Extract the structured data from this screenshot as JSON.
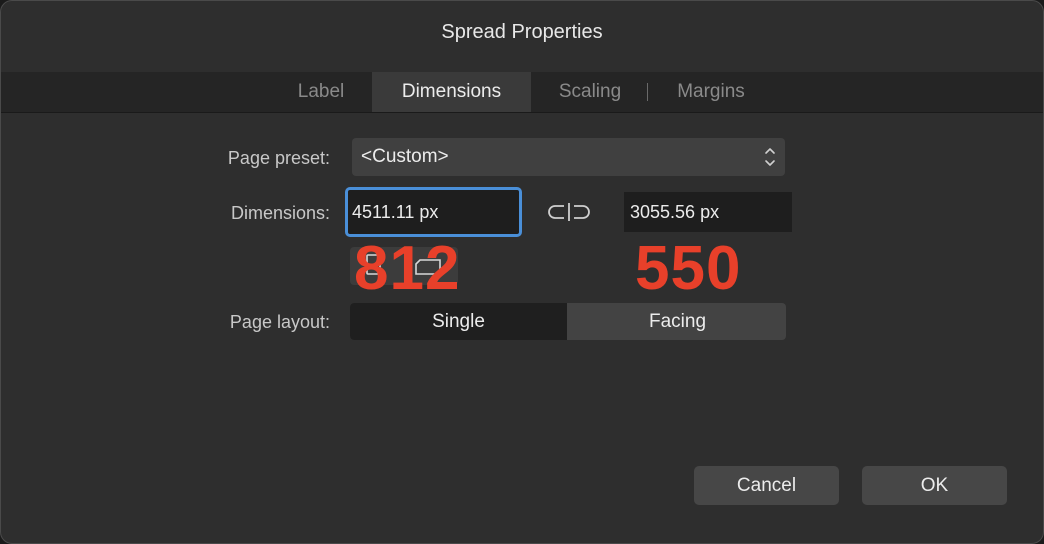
{
  "dialog": {
    "title": "Spread Properties"
  },
  "tabs": [
    {
      "label": "Label"
    },
    {
      "label": "Dimensions"
    },
    {
      "label": "Scaling"
    },
    {
      "label": "Margins"
    }
  ],
  "active_tab": "Dimensions",
  "page_preset": {
    "label": "Page preset:",
    "value": "<Custom>"
  },
  "dimensions": {
    "label": "Dimensions:",
    "width_value": "4511.11 px",
    "height_value": "3055.56 px",
    "width_annotation": "812",
    "height_annotation": "550"
  },
  "page_layout": {
    "label": "Page layout:",
    "options": [
      "Single",
      "Facing"
    ],
    "selected": "Single"
  },
  "buttons": {
    "cancel": "Cancel",
    "ok": "OK"
  },
  "colors": {
    "focus_ring": "#4a8fd8",
    "annotation": "#e8402a",
    "dialog_bg": "#2e2e2e"
  },
  "icons": {
    "link": "chain-link-icon",
    "preset_arrows": "up-down-chevron-icon",
    "portrait": "portrait-orientation-icon",
    "landscape": "landscape-orientation-icon"
  }
}
